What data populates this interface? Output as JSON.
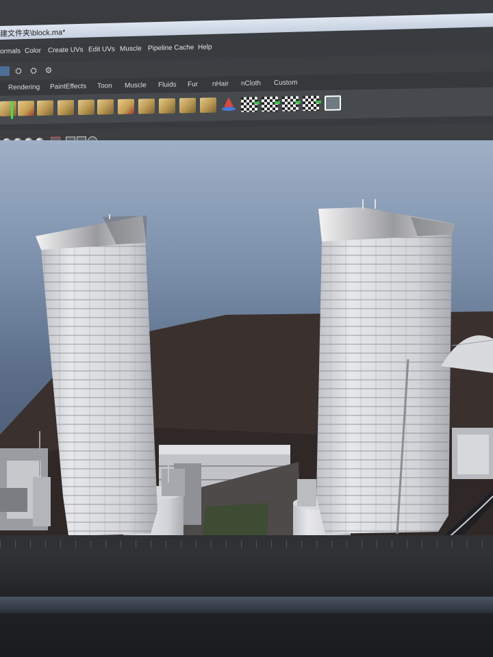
{
  "window": {
    "title": "建文件夹\\block.ma*"
  },
  "menu": {
    "items": [
      "ormals",
      "Color",
      "Create UVs",
      "Edit UVs",
      "Muscle",
      "Pipeline Cache",
      "Help"
    ]
  },
  "shelf": {
    "tabs": [
      "Rendering",
      "PaintEffects",
      "Toon",
      "Muscle",
      "Fluids",
      "Fur",
      "nHair",
      "nCloth",
      "Custom"
    ],
    "tools": [
      "uv-planar-icon",
      "uv-cylindrical-icon",
      "uv-spherical-icon",
      "uv-automatic-icon",
      "uv-unfold-icon",
      "uv-layout-icon",
      "uv-normalize-icon",
      "uv-grid-icon",
      "uv-cut-icon",
      "uv-sew-icon",
      "uv-move-sew-icon",
      "uv-texture-editor-icon",
      "cone-icon",
      "checker-uv-icon-1",
      "checker-uv-icon-2",
      "checker-uv-icon-3",
      "checker-uv-icon-4",
      "uv-snapshot-icon"
    ]
  },
  "colors": {
    "menubar": "#3a3b3e",
    "shelf": "#464a4e",
    "sky_top": "#9fb0c6",
    "sky_bottom": "#3f4d63",
    "ground": "#3a312f",
    "building": "#d8d9dc",
    "accent_green": "#3ee24f"
  },
  "viewport": {
    "scene": "city-block-model"
  }
}
